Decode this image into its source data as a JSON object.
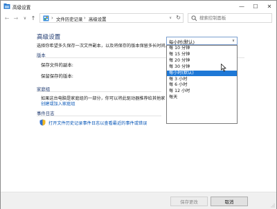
{
  "window": {
    "title": "高级设置",
    "controls": {
      "minimize": "—",
      "maximize": "☐",
      "close": "✕"
    }
  },
  "address_bar": {
    "crumbs": [
      "文件历史记录",
      "高级设置"
    ],
    "separator": "›",
    "dropdown_glyph": "∨",
    "refresh_glyph": "↻"
  },
  "search": {
    "placeholder": "搜索控制面板"
  },
  "nav": {
    "back": "←",
    "forward": "→",
    "recent": "∨",
    "up": "↑"
  },
  "main": {
    "title": "高级设置",
    "description": "选择你希望多久保存一次文件副本，以及将保存的版本保留多长时间。",
    "versions_section": "版本",
    "save_copies_label": "保存文件的副本:",
    "keep_versions_label": "保留保存的版本:",
    "homegroup_section": "家庭组",
    "homegroup_text": "如果这台电脑是家庭组的一部分，你可以将此驱动器推荐给其他家",
    "homegroup_link": "创建或加入家庭组",
    "eventlog_section": "事件日志",
    "eventlog_link": "打开文件历史记录事件日志以查看最近的事件或错误"
  },
  "frequency_select": {
    "selected": "每小时(默认)",
    "options": [
      "每 10 分钟",
      "每 15 分钟",
      "每 20 分钟",
      "每 30 分钟",
      "每小时(默认)",
      "每 3 小时",
      "每 6 小时",
      "每 12 小时",
      "每天"
    ],
    "highlighted_index": 4
  },
  "footer": {
    "save_label": "保存更改",
    "cancel_label": "取消"
  },
  "colors": {
    "heading": "#1f3a70",
    "link": "#0a58b8",
    "selection": "#1e78d6"
  }
}
